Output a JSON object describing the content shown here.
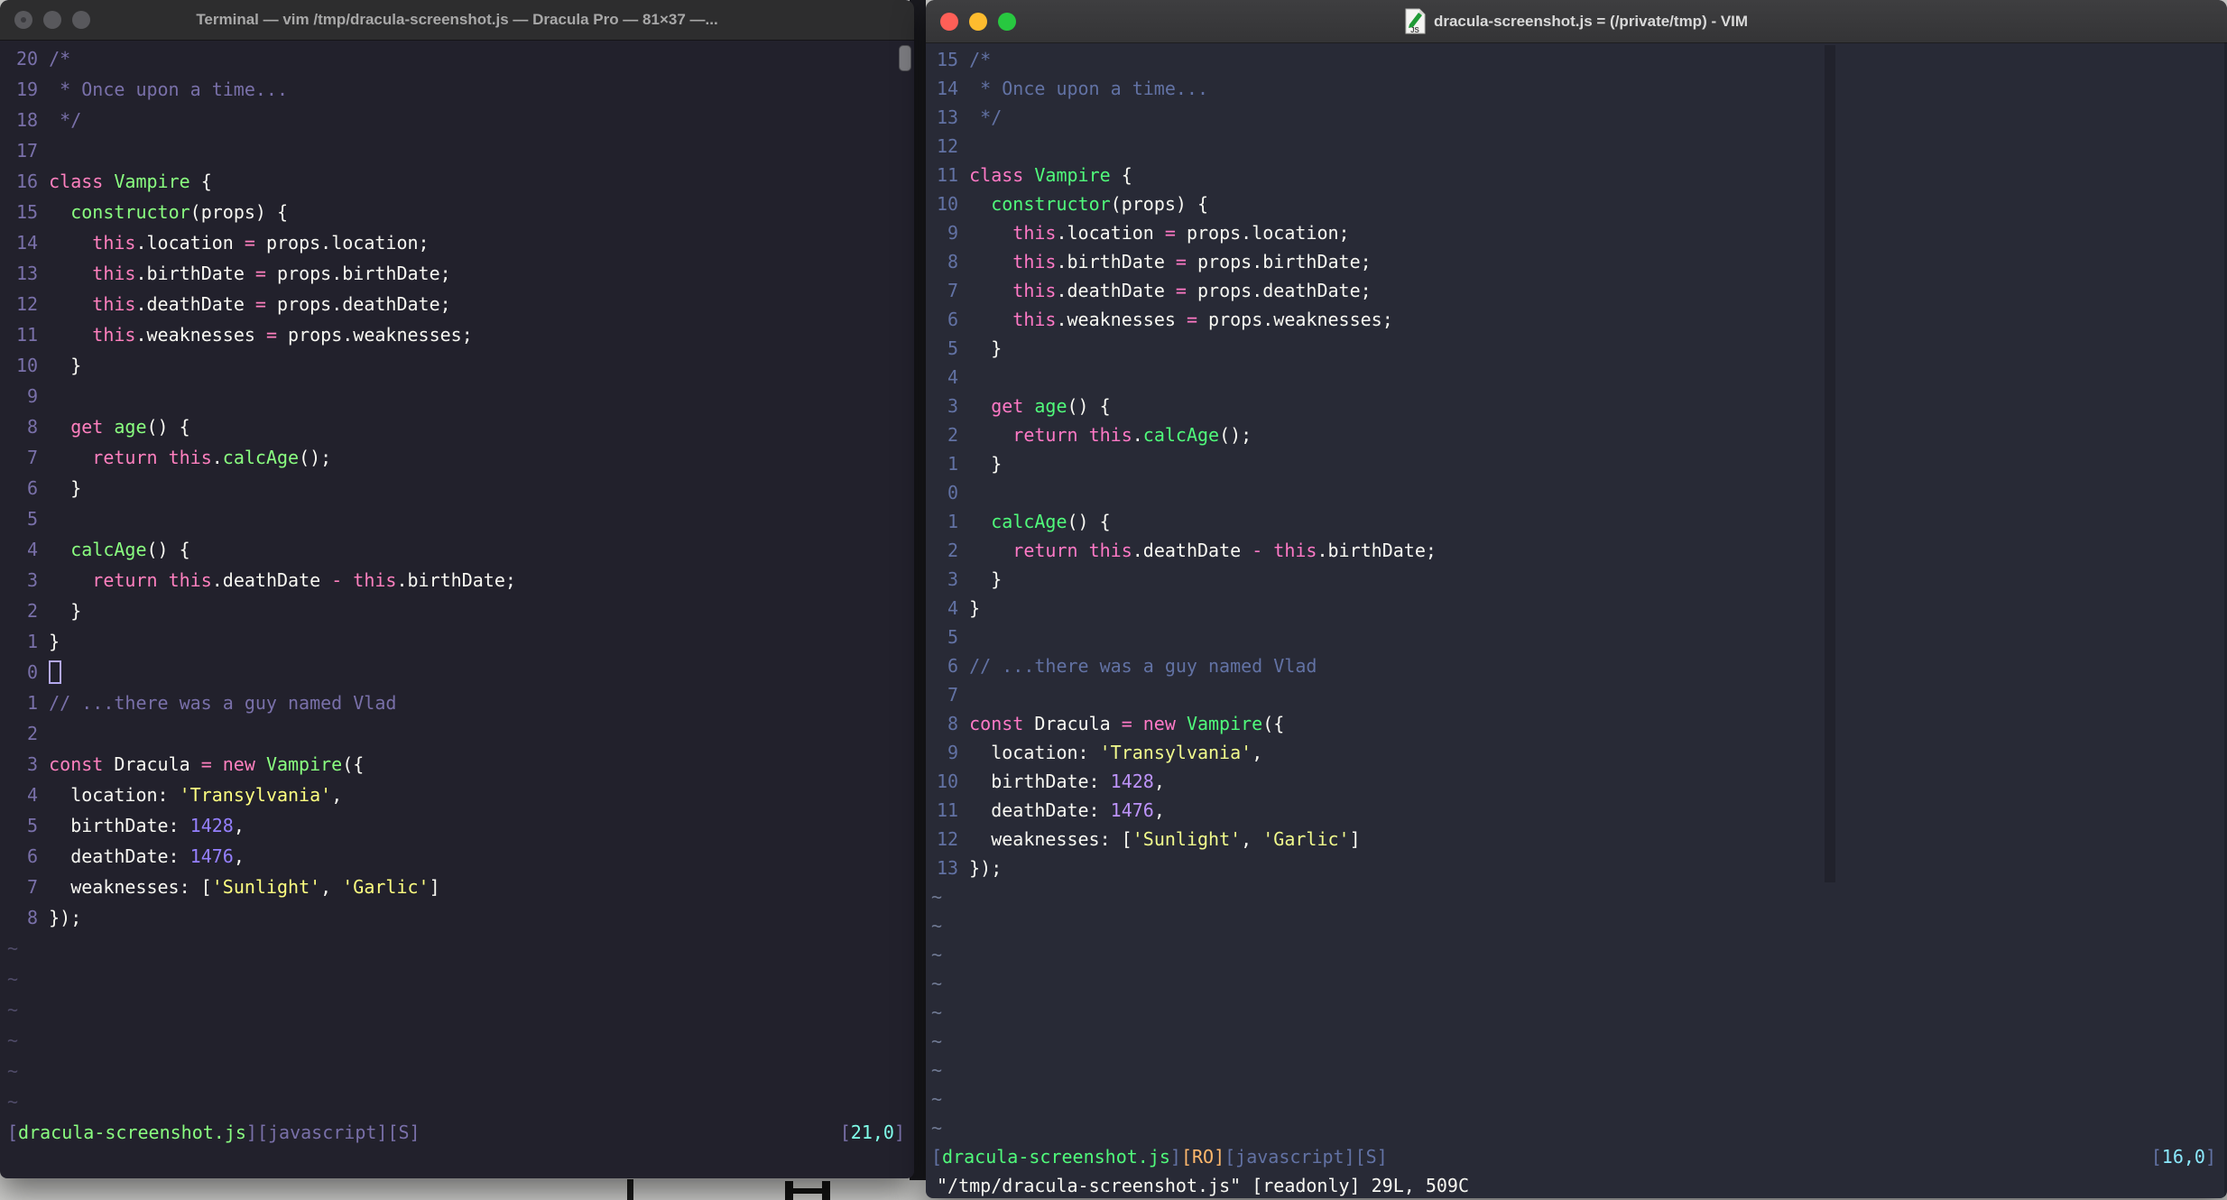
{
  "desktop": {
    "background_color": "#cfcfcd"
  },
  "code": {
    "lines": [
      [
        [
          "c",
          "/*"
        ]
      ],
      [
        [
          "c",
          " * Once upon a time..."
        ]
      ],
      [
        [
          "c",
          " */"
        ]
      ],
      [],
      [
        [
          "p",
          "class "
        ],
        [
          "g",
          "Vampire "
        ],
        [
          "f",
          "{"
        ]
      ],
      [
        [
          "f",
          "  "
        ],
        [
          "g",
          "constructor"
        ],
        [
          "f",
          "(props) {"
        ]
      ],
      [
        [
          "f",
          "    "
        ],
        [
          "p",
          "this"
        ],
        [
          "f",
          ".location "
        ],
        [
          "p",
          "="
        ],
        [
          "f",
          " props.location;"
        ]
      ],
      [
        [
          "f",
          "    "
        ],
        [
          "p",
          "this"
        ],
        [
          "f",
          ".birthDate "
        ],
        [
          "p",
          "="
        ],
        [
          "f",
          " props.birthDate;"
        ]
      ],
      [
        [
          "f",
          "    "
        ],
        [
          "p",
          "this"
        ],
        [
          "f",
          ".deathDate "
        ],
        [
          "p",
          "="
        ],
        [
          "f",
          " props.deathDate;"
        ]
      ],
      [
        [
          "f",
          "    "
        ],
        [
          "p",
          "this"
        ],
        [
          "f",
          ".weaknesses "
        ],
        [
          "p",
          "="
        ],
        [
          "f",
          " props.weaknesses;"
        ]
      ],
      [
        [
          "f",
          "  }"
        ]
      ],
      [],
      [
        [
          "f",
          "  "
        ],
        [
          "p",
          "get "
        ],
        [
          "g",
          "age"
        ],
        [
          "f",
          "() {"
        ]
      ],
      [
        [
          "f",
          "    "
        ],
        [
          "p",
          "return "
        ],
        [
          "p",
          "this"
        ],
        [
          "f",
          "."
        ],
        [
          "g",
          "calcAge"
        ],
        [
          "f",
          "();"
        ]
      ],
      [
        [
          "f",
          "  }"
        ]
      ],
      [],
      [
        [
          "f",
          "  "
        ],
        [
          "g",
          "calcAge"
        ],
        [
          "f",
          "() {"
        ]
      ],
      [
        [
          "f",
          "    "
        ],
        [
          "p",
          "return "
        ],
        [
          "p",
          "this"
        ],
        [
          "f",
          ".deathDate "
        ],
        [
          "p",
          "-"
        ],
        [
          "f",
          " "
        ],
        [
          "p",
          "this"
        ],
        [
          "f",
          ".birthDate;"
        ]
      ],
      [
        [
          "f",
          "  }"
        ]
      ],
      [
        [
          "f",
          "}"
        ]
      ],
      [],
      [
        [
          "c",
          "// ...there was a guy named Vlad"
        ]
      ],
      [],
      [
        [
          "p",
          "const "
        ],
        [
          "f",
          "Dracula "
        ],
        [
          "p",
          "= new "
        ],
        [
          "g",
          "Vampire"
        ],
        [
          "f",
          "({"
        ]
      ],
      [
        [
          "f",
          "  location: "
        ],
        [
          "y",
          "'Transylvania'"
        ],
        [
          "f",
          ","
        ]
      ],
      [
        [
          "f",
          "  birthDate: "
        ],
        [
          "u",
          "1428"
        ],
        [
          "f",
          ","
        ]
      ],
      [
        [
          "f",
          "  deathDate: "
        ],
        [
          "u",
          "1476"
        ],
        [
          "f",
          ","
        ]
      ],
      [
        [
          "f",
          "  weaknesses: ["
        ],
        [
          "y",
          "'Sunlight'"
        ],
        [
          "f",
          ", "
        ],
        [
          "y",
          "'Garlic'"
        ],
        [
          "f",
          "]"
        ]
      ],
      [
        [
          "f",
          "});"
        ]
      ]
    ]
  },
  "left_window": {
    "title": "Terminal — vim /tmp/dracula-screenshot.js — Dracula Pro — 81×37 —...",
    "title_fg": "#a8a8a8",
    "theme_name": "Dracula Pro (Terminal)",
    "palette": {
      "f": "#f8f8f2",
      "c": "#7970a9",
      "p": "#ff80bf",
      "g": "#8aff80",
      "u": "#9580ff",
      "y": "#ffff80",
      "cy": "#80ffea",
      "o": "#ffca80",
      "n": "#7970a9",
      "t": "#4f4b68",
      "cur": "#b4a9ee"
    },
    "line_numbers": [
      "20",
      "19",
      "18",
      "17",
      "16",
      "15",
      "14",
      "13",
      "12",
      "11",
      "10",
      "9",
      "8",
      "7",
      "6",
      "5",
      "4",
      "3",
      "2",
      "1",
      "0",
      "1",
      "2",
      "3",
      "4",
      "5",
      "6",
      "7",
      "8"
    ],
    "cursor_line": 20,
    "tilde_rows": 6,
    "status_left": [
      [
        "n",
        "["
      ],
      [
        "g",
        "dracula-screenshot.js"
      ],
      [
        "n",
        "][javascript][S]"
      ]
    ],
    "status_right": [
      [
        "n",
        "["
      ],
      [
        "cy",
        "21,0"
      ],
      [
        "n",
        "]"
      ]
    ],
    "cmdline": []
  },
  "right_window": {
    "title": "dracula-screenshot.js = (/private/tmp) - VIM",
    "title_fg": "#d9d9d9",
    "theme_name": "Dracula (MacVim)",
    "traffic_colors": {
      "close": "#ff5f57",
      "minimize": "#febc2e",
      "zoom": "#28c840"
    },
    "palette": {
      "f": "#f8f8f2",
      "c": "#6272a4",
      "p": "#ff79c6",
      "g": "#50fa7b",
      "u": "#bd93f9",
      "y": "#f1fa8c",
      "cy": "#8be9fd",
      "o": "#ffb86c",
      "n": "#6272a4",
      "t": "#707a94",
      "cur": "#b4a9ee"
    },
    "line_numbers": [
      "15",
      "14",
      "13",
      "12",
      "11",
      "10",
      "9",
      "8",
      "7",
      "6",
      "5",
      "4",
      "3",
      "2",
      "1",
      "0",
      "1",
      "2",
      "3",
      "4",
      "5",
      "6",
      "7",
      "8",
      "9",
      "10",
      "11",
      "12",
      "13"
    ],
    "cursor_line": null,
    "tilde_rows": 9,
    "status_left": [
      [
        "n",
        "["
      ],
      [
        "g",
        "dracula-screenshot.js"
      ],
      [
        "n",
        "]"
      ],
      [
        "o",
        "[RO]"
      ],
      [
        "n",
        "[javascript][S]"
      ]
    ],
    "status_right": [
      [
        "n",
        "["
      ],
      [
        "cy",
        "16,0"
      ],
      [
        "n",
        "]"
      ]
    ],
    "cmdline": [
      [
        "f",
        "\"/tmp/dracula-screenshot.js\" [readonly] 29L, 509C"
      ]
    ]
  }
}
